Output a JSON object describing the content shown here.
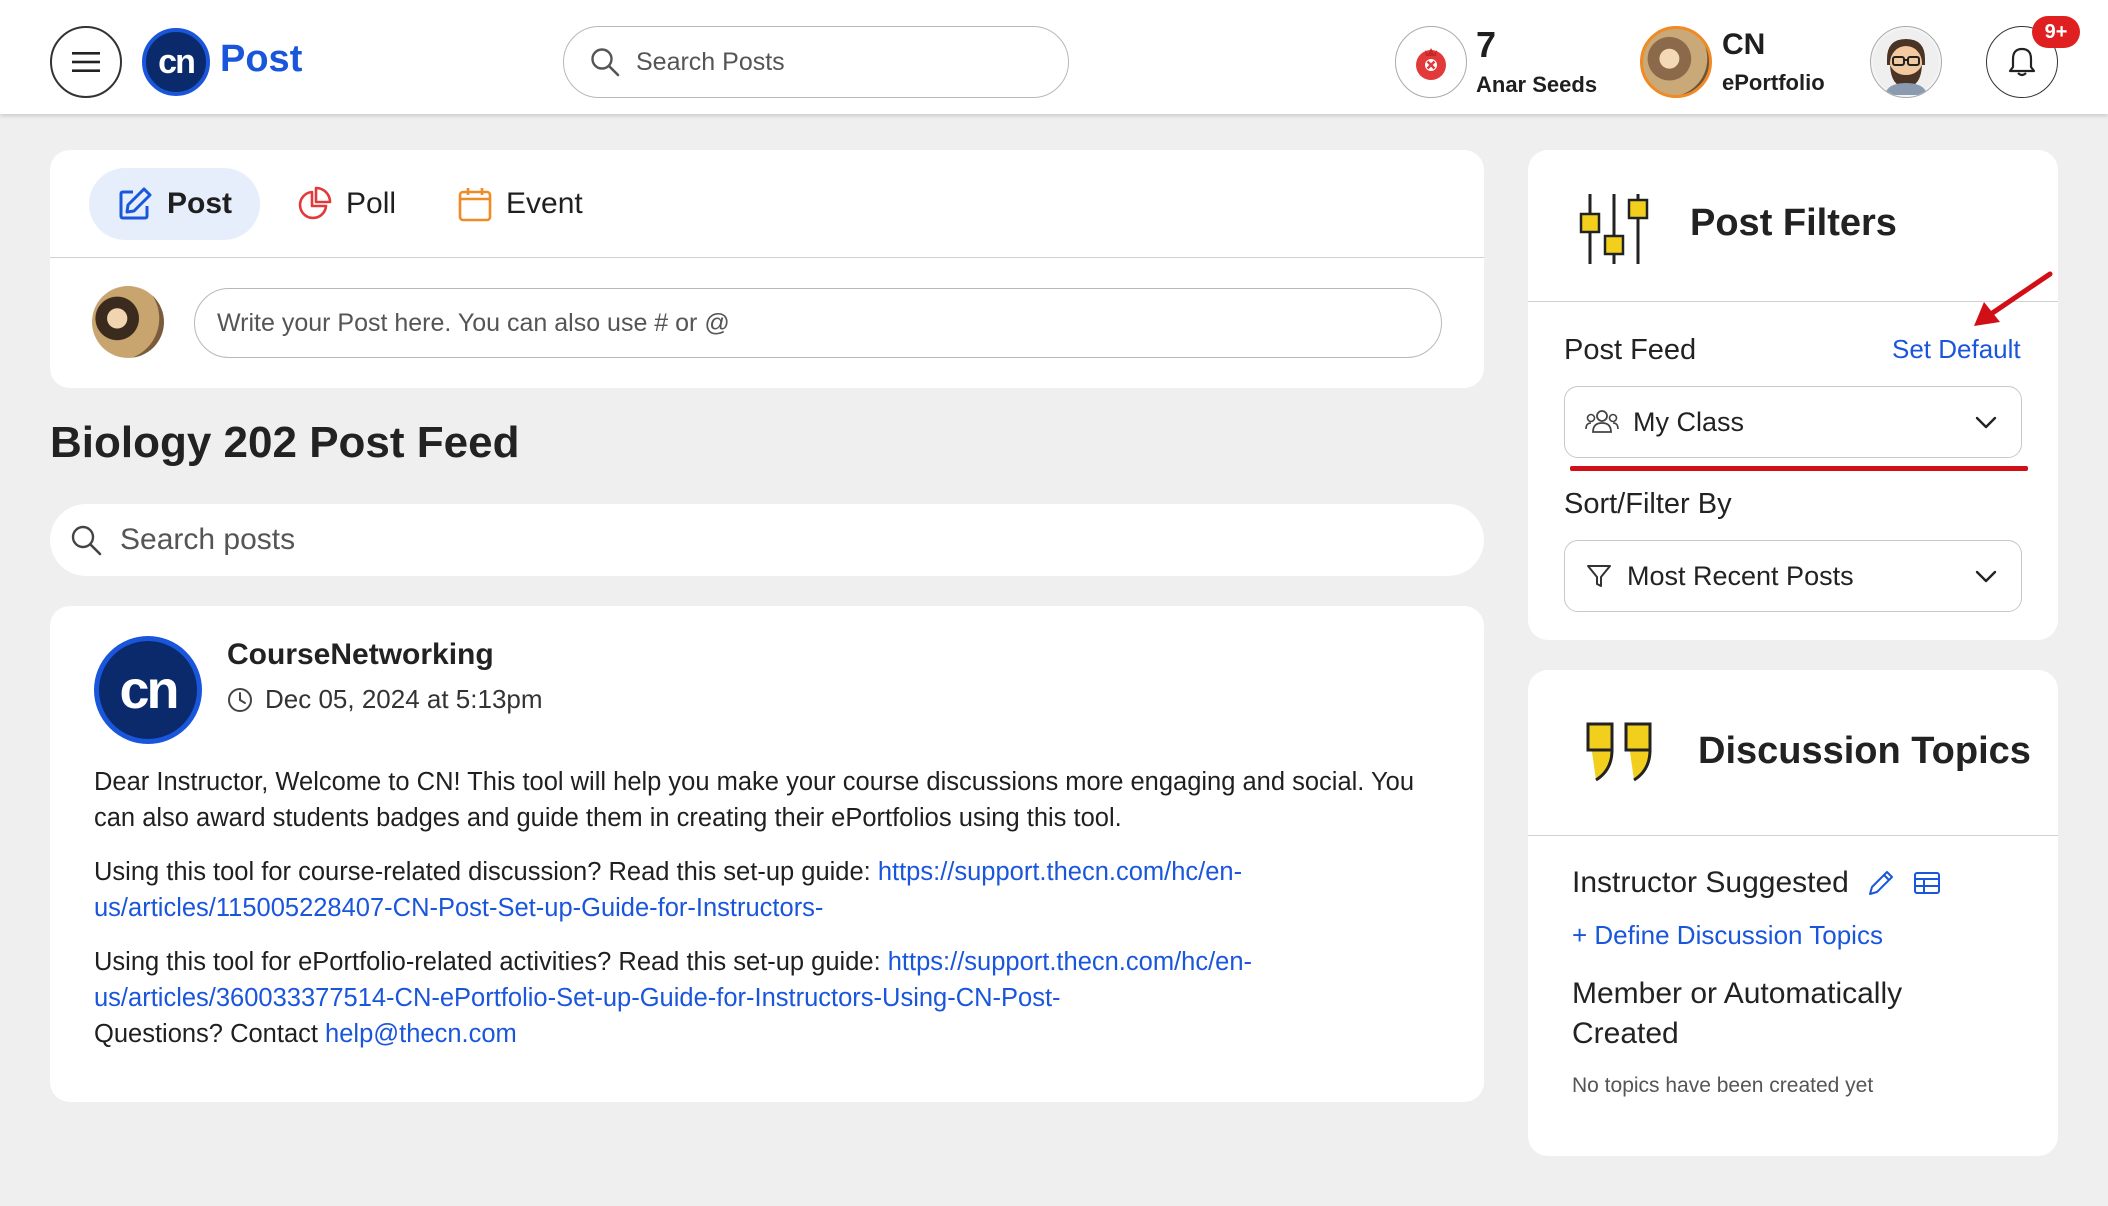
{
  "header": {
    "brand": "Post",
    "logo_text": "cn",
    "search_placeholder": "Search Posts",
    "seeds_count": "7",
    "seeds_label": "Anar Seeds",
    "portfolio_title": "CN",
    "portfolio_sub": "ePortfolio",
    "notification_badge": "9+"
  },
  "composer": {
    "tabs": [
      {
        "label": "Post",
        "icon": "edit-icon",
        "active": true
      },
      {
        "label": "Poll",
        "icon": "pie-chart-icon",
        "active": false
      },
      {
        "label": "Event",
        "icon": "calendar-icon",
        "active": false
      }
    ],
    "placeholder": "Write your Post here. You can also use # or @"
  },
  "feed": {
    "title": "Biology 202 Post Feed",
    "search_placeholder": "Search posts"
  },
  "post": {
    "logo_text": "cn",
    "author": "CourseNetworking",
    "time": "Dec 05, 2024 at 5:13pm",
    "p1": "Dear Instructor, Welcome to CN! This tool will help you make your course discussions more engaging and social. You can also award students badges and guide them in creating their ePortfolios using this tool.",
    "p2_text": "Using this tool for course-related discussion? Read this set-up guide: ",
    "p2_link": "https://support.thecn.com/hc/en-us/articles/115005228407-CN-Post-Set-up-Guide-for-Instructors-",
    "p3_text": "Using this tool for ePortfolio-related activities? Read this set-up guide: ",
    "p3_link": "https://support.thecn.com/hc/en-us/articles/360033377514-CN-ePortfolio-Set-up-Guide-for-Instructors-Using-CN-Post-",
    "p4_text": "Questions? Contact ",
    "p4_link": "help@thecn.com"
  },
  "filters": {
    "title": "Post Filters",
    "post_feed_label": "Post Feed",
    "set_default": "Set Default",
    "post_feed_value": "My Class",
    "sort_label": "Sort/Filter By",
    "sort_value": "Most Recent Posts"
  },
  "topics": {
    "title": "Discussion Topics",
    "instructor_suggested": "Instructor Suggested",
    "define": "+ Define Discussion Topics",
    "member_created": "Member or Automatically Created",
    "empty": "No topics have been created yet"
  },
  "colors": {
    "accent": "#1a56db",
    "brand_navy": "#0b2a6b",
    "annotation_red": "#d10f16",
    "filter_yellow": "#f2cf1d",
    "badge_red": "#e02020"
  }
}
